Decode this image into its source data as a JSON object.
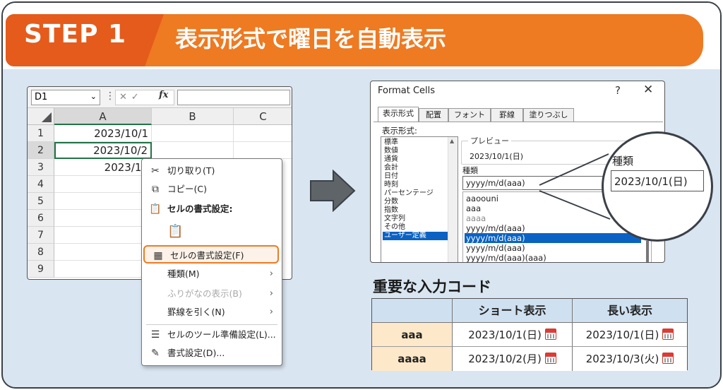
{
  "banner": {
    "step": "STEP 1",
    "title": "表示形式で曜日を自動表示"
  },
  "excel": {
    "name_box": "D1",
    "fx": "fx",
    "columns": [
      "A",
      "B",
      "C"
    ],
    "rows": [
      "1",
      "2",
      "3",
      "4",
      "5",
      "6",
      "7",
      "8",
      "9"
    ],
    "cells": [
      "2023/10/1",
      "2023/10/2",
      "2023/10"
    ]
  },
  "context_menu": {
    "items": [
      {
        "icon": "scissors-icon",
        "label": "切り取り(T)"
      },
      {
        "icon": "copy-icon",
        "label": "コピー(C)"
      },
      {
        "icon": "paste-icon",
        "label": "セルの書式設定:"
      },
      {
        "icon": "format-cells-icon",
        "label": "セルの書式設定(F)"
      },
      {
        "label": "種類(M)"
      },
      {
        "label": "ふりがなの表示(B)"
      },
      {
        "label": "罫線を引く(N)"
      },
      {
        "icon": "list-icon",
        "label": "セルのツール準備設定(L)..."
      },
      {
        "icon": "edit-icon",
        "label": "書式設定(D)..."
      }
    ]
  },
  "dialog": {
    "title": "Format Cells",
    "help": "?",
    "close": "✕",
    "tabs": [
      "表示形式",
      "配置",
      "フォント",
      "罫線",
      "塗りつぶし"
    ],
    "category_label": "表示形式:",
    "categories": [
      "標準",
      "数値",
      "通貨",
      "会計",
      "日付",
      "時刻",
      "パーセンテージ",
      "分数",
      "指数",
      "文字列",
      "その他",
      "ユーザー定義"
    ],
    "selected_category": 11,
    "preview_label": "プレビュー",
    "preview_value": "2023/10/1(日)",
    "type_label": "種類",
    "type_value": "yyyy/m/d(aaa)",
    "formats": [
      "aaoouni",
      "aaa",
      "aaaa",
      "yyyy/m/d(aaa)",
      "yyyy/m/d(aaa)",
      "yyyy/m/d(aaa)",
      "yyyy/m/d(aaa)(aaa)"
    ],
    "selected_format": 4
  },
  "magnifier": {
    "label": "種類",
    "value": "2023/10/1(日)"
  },
  "code_table": {
    "title": "重要な入力コード",
    "headers": [
      "",
      "ショート表示",
      "長い表示"
    ],
    "rows": [
      {
        "code": "aaa",
        "short": "2023/10/1(日)",
        "long": "2023/10/1(日)"
      },
      {
        "code": "aaaa",
        "short": "2023/10/2(月)",
        "long": "2023/10/3(火)"
      }
    ]
  },
  "colors": {
    "accent_orange": "#ee7a22",
    "step_orange": "#e55b1b",
    "background": "#d9e5f1",
    "selection_blue": "#0b62c3",
    "excel_green": "#217346",
    "table_header": "#cfe0f0",
    "code_cell": "#fde9c9"
  }
}
